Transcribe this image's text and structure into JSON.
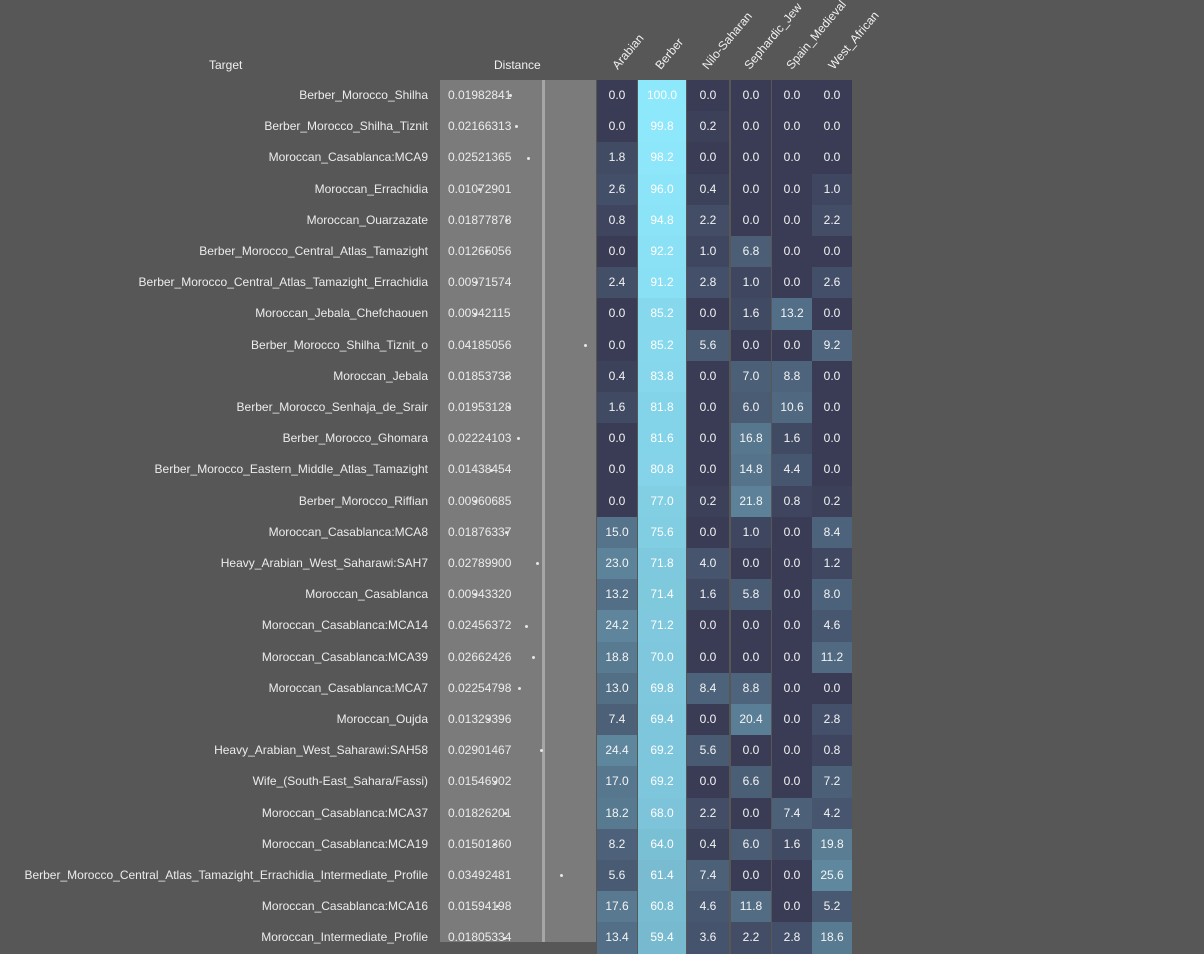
{
  "headers": {
    "target": "Target",
    "distance": "Distance",
    "columns": [
      "Arabian",
      "Berber",
      "Nilo-Saharan",
      "Sephardic_Jew",
      "Spain_Medieval",
      "West_African"
    ]
  },
  "colors": {
    "background": "#575757",
    "distance_panel": "#7b7b7b",
    "heat_low": "#3a3c55",
    "heat_high": "#8ee8fc"
  },
  "rows": [
    {
      "target": "Berber_Morocco_Shilha",
      "distance": "0.01982841",
      "values": [
        0.0,
        100.0,
        0.0,
        0.0,
        0.0,
        0.0
      ]
    },
    {
      "target": "Berber_Morocco_Shilha_Tiznit",
      "distance": "0.02166313",
      "values": [
        0.0,
        99.8,
        0.2,
        0.0,
        0.0,
        0.0
      ]
    },
    {
      "target": "Moroccan_Casablanca:MCA9",
      "distance": "0.02521365",
      "values": [
        1.8,
        98.2,
        0.0,
        0.0,
        0.0,
        0.0
      ]
    },
    {
      "target": "Moroccan_Errachidia",
      "distance": "0.01072901",
      "values": [
        2.6,
        96.0,
        0.4,
        0.0,
        0.0,
        1.0
      ]
    },
    {
      "target": "Moroccan_Ouarzazate",
      "distance": "0.01877878",
      "values": [
        0.8,
        94.8,
        2.2,
        0.0,
        0.0,
        2.2
      ]
    },
    {
      "target": "Berber_Morocco_Central_Atlas_Tamazight",
      "distance": "0.01265056",
      "values": [
        0.0,
        92.2,
        1.0,
        6.8,
        0.0,
        0.0
      ]
    },
    {
      "target": "Berber_Morocco_Central_Atlas_Tamazight_Errachidia",
      "distance": "0.00971574",
      "values": [
        2.4,
        91.2,
        2.8,
        1.0,
        0.0,
        2.6
      ]
    },
    {
      "target": "Moroccan_Jebala_Chefchaouen",
      "distance": "0.00942115",
      "values": [
        0.0,
        85.2,
        0.0,
        1.6,
        13.2,
        0.0
      ]
    },
    {
      "target": "Berber_Morocco_Shilha_Tiznit_o",
      "distance": "0.04185056",
      "values": [
        0.0,
        85.2,
        5.6,
        0.0,
        0.0,
        9.2
      ]
    },
    {
      "target": "Moroccan_Jebala",
      "distance": "0.01853733",
      "values": [
        0.4,
        83.8,
        0.0,
        7.0,
        8.8,
        0.0
      ]
    },
    {
      "target": "Berber_Morocco_Senhaja_de_Srair",
      "distance": "0.01953128",
      "values": [
        1.6,
        81.8,
        0.0,
        6.0,
        10.6,
        0.0
      ]
    },
    {
      "target": "Berber_Morocco_Ghomara",
      "distance": "0.02224103",
      "values": [
        0.0,
        81.6,
        0.0,
        16.8,
        1.6,
        0.0
      ]
    },
    {
      "target": "Berber_Morocco_Eastern_Middle_Atlas_Tamazight",
      "distance": "0.01438454",
      "values": [
        0.0,
        80.8,
        0.0,
        14.8,
        4.4,
        0.0
      ]
    },
    {
      "target": "Berber_Morocco_Riffian",
      "distance": "0.00960685",
      "values": [
        0.0,
        77.0,
        0.2,
        21.8,
        0.8,
        0.2
      ]
    },
    {
      "target": "Moroccan_Casablanca:MCA8",
      "distance": "0.01876337",
      "values": [
        15.0,
        75.6,
        0.0,
        1.0,
        0.0,
        8.4
      ]
    },
    {
      "target": "Heavy_Arabian_West_Saharawi:SAH7",
      "distance": "0.02789900",
      "values": [
        23.0,
        71.8,
        4.0,
        0.0,
        0.0,
        1.2
      ]
    },
    {
      "target": "Moroccan_Casablanca",
      "distance": "0.00943320",
      "values": [
        13.2,
        71.4,
        1.6,
        5.8,
        0.0,
        8.0
      ]
    },
    {
      "target": "Moroccan_Casablanca:MCA14",
      "distance": "0.02456372",
      "values": [
        24.2,
        71.2,
        0.0,
        0.0,
        0.0,
        4.6
      ]
    },
    {
      "target": "Moroccan_Casablanca:MCA39",
      "distance": "0.02662426",
      "values": [
        18.8,
        70.0,
        0.0,
        0.0,
        0.0,
        11.2
      ]
    },
    {
      "target": "Moroccan_Casablanca:MCA7",
      "distance": "0.02254798",
      "values": [
        13.0,
        69.8,
        8.4,
        8.8,
        0.0,
        0.0
      ]
    },
    {
      "target": "Moroccan_Oujda",
      "distance": "0.01329396",
      "values": [
        7.4,
        69.4,
        0.0,
        20.4,
        0.0,
        2.8
      ]
    },
    {
      "target": "Heavy_Arabian_West_Saharawi:SAH58",
      "distance": "0.02901467",
      "values": [
        24.4,
        69.2,
        5.6,
        0.0,
        0.0,
        0.8
      ]
    },
    {
      "target": "Wife_(South-East_Sahara/Fassi)",
      "distance": "0.01546902",
      "values": [
        17.0,
        69.2,
        0.0,
        6.6,
        0.0,
        7.2
      ]
    },
    {
      "target": "Moroccan_Casablanca:MCA37",
      "distance": "0.01826201",
      "values": [
        18.2,
        68.0,
        2.2,
        0.0,
        7.4,
        4.2
      ]
    },
    {
      "target": "Moroccan_Casablanca:MCA19",
      "distance": "0.01501360",
      "values": [
        8.2,
        64.0,
        0.4,
        6.0,
        1.6,
        19.8
      ]
    },
    {
      "target": "Berber_Morocco_Central_Atlas_Tamazight_Errachidia_Intermediate_Profile",
      "distance": "0.03492481",
      "values": [
        5.6,
        61.4,
        7.4,
        0.0,
        0.0,
        25.6
      ]
    },
    {
      "target": "Moroccan_Casablanca:MCA16",
      "distance": "0.01594198",
      "values": [
        17.6,
        60.8,
        4.6,
        11.8,
        0.0,
        5.2
      ]
    },
    {
      "target": "Moroccan_Intermediate_Profile",
      "distance": "0.01805334",
      "values": [
        13.4,
        59.4,
        3.6,
        2.2,
        2.8,
        18.6
      ]
    }
  ]
}
